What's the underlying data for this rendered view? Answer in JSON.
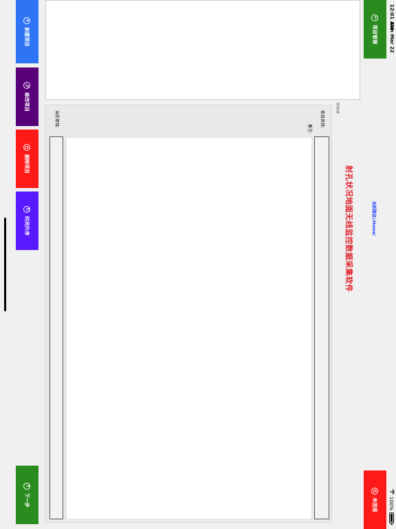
{
  "status_bar": {
    "time": "12:01 AM",
    "date": "Sun Mar 22",
    "battery": "100%"
  },
  "header": {
    "project_manage_label": "项目管理",
    "current_path": "当前路径:/Home/",
    "not_connected_label": "未连接",
    "app_title": "射孔状况地面无线监控数据采集软件"
  },
  "info_panel": {
    "label": "项目信息"
  },
  "form": {
    "project_name_label": "项目名称:",
    "note_label": "备注:",
    "current_project_label": "当前项目:"
  },
  "actions": {
    "new_project": "新建项目",
    "edit_project": "修改项目",
    "delete_project": "删除项目",
    "sort": "时间升序",
    "next": "下一步"
  },
  "colors": {
    "green": "#2a8c1f",
    "red": "#ff1a1a",
    "blue": "#2e74f5",
    "purple": "#57007a",
    "violet": "#5a1aff",
    "title_red": "#e01f2a",
    "path_blue": "#1a3cff"
  }
}
